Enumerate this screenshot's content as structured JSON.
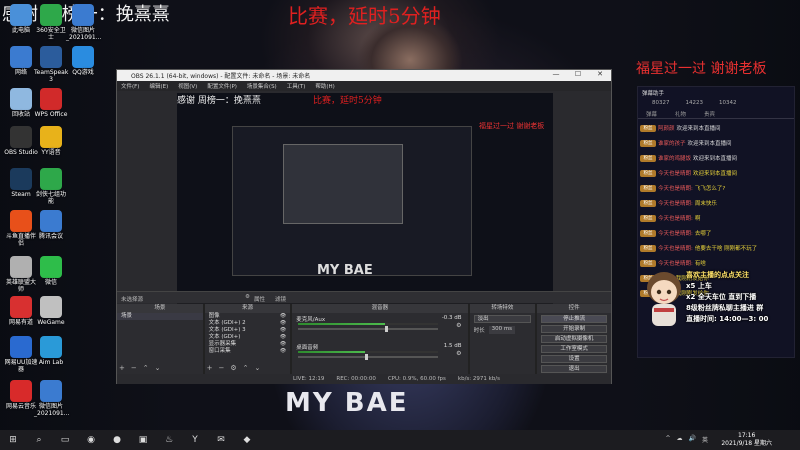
{
  "overlay": {
    "top_left_text": "感谢 周榜一：挽熹熹",
    "top_center_text": "比赛，延时5分钟",
    "right_text": "福星过一过 谢谢老板",
    "shirt_text": "MY BAE"
  },
  "desktop_icons": [
    {
      "label": "此电脑",
      "icon": "computer-icon",
      "color": "#4a90d9"
    },
    {
      "label": "360安全卫士",
      "icon": "shield-icon",
      "color": "#2ea84a"
    },
    {
      "label": "微信图片_2021091...",
      "icon": "image-icon",
      "color": "#3b7bd0"
    },
    {
      "label": "网络",
      "icon": "network-icon",
      "color": "#3b7bd0"
    },
    {
      "label": "TeamSpeak 3",
      "icon": "teamspeak-icon",
      "color": "#2b5c9c"
    },
    {
      "label": "QQ游戏",
      "icon": "qqgame-icon",
      "color": "#2a8ce0"
    },
    {
      "label": "回收站",
      "icon": "recycle-bin-icon",
      "color": "#8fb8e0"
    },
    {
      "label": "WPS Office",
      "icon": "wps-icon",
      "color": "#d12a2a"
    },
    {
      "label": "OBS Studio",
      "icon": "obs-icon",
      "color": "#333333"
    },
    {
      "label": "YY语音",
      "icon": "yy-icon",
      "color": "#e8b21a"
    },
    {
      "label": "Steam",
      "icon": "steam-icon",
      "color": "#1b3a5c"
    },
    {
      "label": "剑侠七组功能",
      "icon": "app-icon",
      "color": "#2ea84a"
    },
    {
      "label": "斗鱼直播伴侣",
      "icon": "douyu-icon",
      "color": "#e8501a"
    },
    {
      "label": "腾讯会议",
      "icon": "meeting-icon",
      "color": "#3b7bd0"
    },
    {
      "label": "英雄联盟大师",
      "icon": "lol-icon",
      "color": "#b0b0b0"
    },
    {
      "label": "微信",
      "icon": "wechat-icon",
      "color": "#2ebd4a"
    },
    {
      "label": "网易有道",
      "icon": "youdao-icon",
      "color": "#d83030"
    },
    {
      "label": "WeGame",
      "icon": "wegame-icon",
      "color": "#c0c0c0"
    },
    {
      "label": "网易UU加速器",
      "icon": "uu-icon",
      "color": "#2a6ad0"
    },
    {
      "label": "Aim Lab",
      "icon": "aimlab-icon",
      "color": "#2a9ad8"
    },
    {
      "label": "网易云音乐",
      "icon": "music-icon",
      "color": "#d82a2a"
    },
    {
      "label": "微信图片_2021091...",
      "icon": "image-icon",
      "color": "#3b7bd0"
    }
  ],
  "obs": {
    "title": "OBS 26.1.1 (64-bit, windows) - 配置文件: 未命名 - 场景: 未命名",
    "menu": [
      "文件(F)",
      "编辑(E)",
      "视图(V)",
      "配置文件(P)",
      "场景集合(S)",
      "工具(T)",
      "帮助(H)"
    ],
    "preview_texts": {
      "left": "感谢 周榜一：挽熹熹",
      "center": "比赛，延时5分钟",
      "right": "福星过一过 谢谢老板",
      "shirt": "MY BAE"
    },
    "dock_bar": {
      "label": "未选择源",
      "props": "属性",
      "filters": "滤镜"
    },
    "scenes": {
      "header": "场景",
      "items": [
        "场景"
      ]
    },
    "sources": {
      "header": "来源",
      "items": [
        "图像",
        "文本 (GDI+) 2",
        "文本 (GDI+) 3",
        "文本 (GDI+)",
        "显示器采集",
        "窗口采集"
      ]
    },
    "mixer": {
      "header": "混音器",
      "channels": [
        {
          "name": "麦克风/Aux",
          "db": "-0.3 dB",
          "level": 0.62
        },
        {
          "name": "桌面音频",
          "db": "1.5 dB",
          "level": 0.48
        }
      ]
    },
    "transitions": {
      "header": "转场特效",
      "type": "淡出",
      "duration_label": "时长",
      "duration": "300 ms"
    },
    "controls": {
      "header": "控件",
      "buttons": [
        "停止推流",
        "开始录制",
        "启动虚拟摄像机",
        "工作室模式",
        "设置",
        "退出"
      ]
    },
    "status": {
      "live": "LIVE: 12:19",
      "rec": "REC: 00:00:00",
      "cpu": "CPU: 0.9%, 60.00 fps",
      "kbps": "kb/s: 2971 kb/s"
    }
  },
  "chat": {
    "header": "弹幕助手",
    "stats": [
      "80327",
      "14223",
      "10342"
    ],
    "tabs": [
      "弹幕",
      "礼物",
      "贵宾"
    ],
    "messages": [
      {
        "badge": "粉丝",
        "name": "阿颜颜",
        "text": "欢迎来到本直播间"
      },
      {
        "badge": "粉丝",
        "name": "谁家的孩子",
        "text": "欢迎来到本直播间"
      },
      {
        "badge": "粉丝",
        "name": "谁家的鸡腿饭",
        "text": "欢迎来到本直播间"
      },
      {
        "badge": "粉丝",
        "name": "今天也是晴朗",
        "text": "欢迎来到本直播间"
      },
      {
        "badge": "粉丝",
        "name": "今天也是晴朗:",
        "text": "飞飞怎么了?"
      },
      {
        "badge": "粉丝",
        "name": "今天也是晴朗:",
        "text": "周末快乐"
      },
      {
        "badge": "粉丝",
        "name": "今天也是晴朗:",
        "text": "啊"
      },
      {
        "badge": "粉丝",
        "name": "今天也是晴朗:",
        "text": "去哪了"
      },
      {
        "badge": "粉丝",
        "name": "今天也是晴朗:",
        "text": "他要去干啥 刚刚都不玩了"
      },
      {
        "badge": "粉丝",
        "name": "今天也是晴朗:",
        "text": "有啥"
      },
      {
        "badge": "粉丝",
        "name": "vl声音",
        "text": "我刚刚发给你"
      },
      {
        "badge": "粉丝",
        "name": "vl声音",
        "text": "我刚刚发给你"
      }
    ],
    "notice_lines": [
      "喜欢主播的点点关注",
      "x5 上车",
      "x2 全天车位 直到下播",
      "8级粉丝牌私聊主播进 群",
      "直播时间: 14:00—3: 00"
    ]
  },
  "taskbar": {
    "items": [
      "windows-icon",
      "search-icon",
      "task-view-icon",
      "chrome-icon",
      "obs-icon",
      "file-explorer-icon",
      "steam-icon",
      "yy-icon",
      "wechat-icon",
      "douyu-icon"
    ],
    "time": "17:16",
    "date": "2021/9/18 星期六",
    "tray": [
      "^",
      "☁",
      "🔊",
      "英"
    ]
  }
}
